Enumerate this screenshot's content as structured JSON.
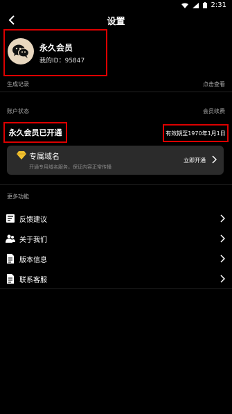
{
  "status_bar": {
    "time": "2:31"
  },
  "header": {
    "title": "设置"
  },
  "profile": {
    "name": "永久会员",
    "id_label": "我的ID：",
    "id_value": "95847"
  },
  "records": {
    "label": "生成记录",
    "action": "点击查看"
  },
  "account": {
    "label": "账户状态",
    "action": "会员续费",
    "status": "永久会员已开通",
    "expiry": "有效期至1970年1月1日"
  },
  "domain_card": {
    "title": "专属域名",
    "subtitle": "开通专用域名服务，保证内容正常传播",
    "action": "立即开通"
  },
  "more": {
    "title": "更多功能",
    "items": [
      {
        "label": "反馈建议",
        "icon": "feedback-icon"
      },
      {
        "label": "关于我们",
        "icon": "people-icon"
      },
      {
        "label": "版本信息",
        "icon": "document-icon"
      },
      {
        "label": "联系客服",
        "icon": "service-document-icon"
      }
    ]
  },
  "colors": {
    "highlight": "#dd0000",
    "card": "#2b2b2b",
    "gem": "#f2c230"
  }
}
